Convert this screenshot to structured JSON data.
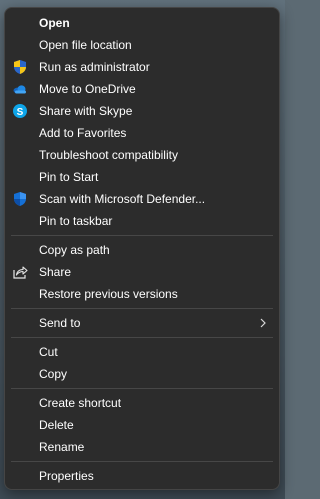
{
  "menu": {
    "open": "Open",
    "open_file_location": "Open file location",
    "run_as_admin": "Run as administrator",
    "move_to_onedrive": "Move to OneDrive",
    "share_with_skype": "Share with Skype",
    "add_to_favorites": "Add to Favorites",
    "troubleshoot": "Troubleshoot compatibility",
    "pin_to_start": "Pin to Start",
    "scan_defender": "Scan with Microsoft Defender...",
    "pin_to_taskbar": "Pin to taskbar",
    "copy_as_path": "Copy as path",
    "share": "Share",
    "restore_previous": "Restore previous versions",
    "send_to": "Send to",
    "cut": "Cut",
    "copy": "Copy",
    "create_shortcut": "Create shortcut",
    "delete": "Delete",
    "rename": "Rename",
    "properties": "Properties"
  },
  "icons": {
    "run_as_admin": "uac-shield-icon",
    "move_to_onedrive": "onedrive-cloud-icon",
    "share_with_skype": "skype-icon",
    "scan_defender": "defender-shield-icon",
    "share": "share-icon",
    "send_to": "chevron-right-icon"
  },
  "colors": {
    "menu_background": "#2c2c2c",
    "text": "#ffffff",
    "separator": "#474747",
    "onedrive_blue": "#1e88e5",
    "skype_blue": "#0ea5e9",
    "defender_blue": "#1570d6",
    "uac_yellow": "#f5c518"
  }
}
